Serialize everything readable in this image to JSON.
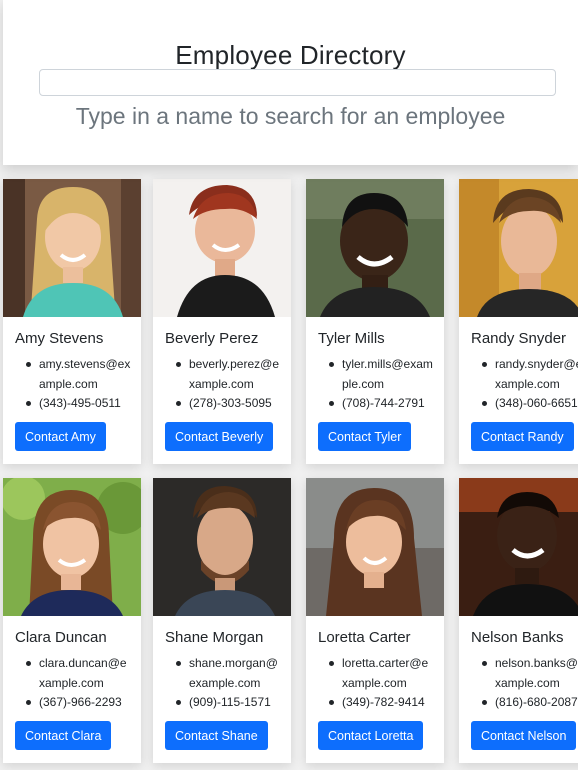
{
  "header": {
    "title": "Employee Directory",
    "search_placeholder": "",
    "subtitle": "Type in a name to search for an employee"
  },
  "employees": [
    {
      "name": "Amy Stevens",
      "email": "amy.stevens@example.com",
      "phone": "(343)-495-0511",
      "button": "Contact Amy"
    },
    {
      "name": "Beverly Perez",
      "email": "beverly.perez@example.com",
      "phone": "(278)-303-5095",
      "button": "Contact Beverly"
    },
    {
      "name": "Tyler Mills",
      "email": "tyler.mills@example.com",
      "phone": "(708)-744-2791",
      "button": "Contact Tyler"
    },
    {
      "name": "Randy Snyder",
      "email": "randy.snyder@example.com",
      "phone": "(348)-060-6651",
      "button": "Contact Randy"
    },
    {
      "name": "Clara Duncan",
      "email": "clara.duncan@example.com",
      "phone": "(367)-966-2293",
      "button": "Contact Clara"
    },
    {
      "name": "Shane Morgan",
      "email": "shane.morgan@example.com",
      "phone": "(909)-115-1571",
      "button": "Contact Shane"
    },
    {
      "name": "Loretta Carter",
      "email": "loretta.carter@example.com",
      "phone": "(349)-782-9414",
      "button": "Contact Loretta"
    },
    {
      "name": "Nelson Banks",
      "email": "nelson.banks@example.com",
      "phone": "(816)-680-2087",
      "button": "Contact Nelson"
    }
  ],
  "colors": {
    "accent": "#0d6efd",
    "subtitle": "#6c757d",
    "background": "#f0f0f0"
  }
}
